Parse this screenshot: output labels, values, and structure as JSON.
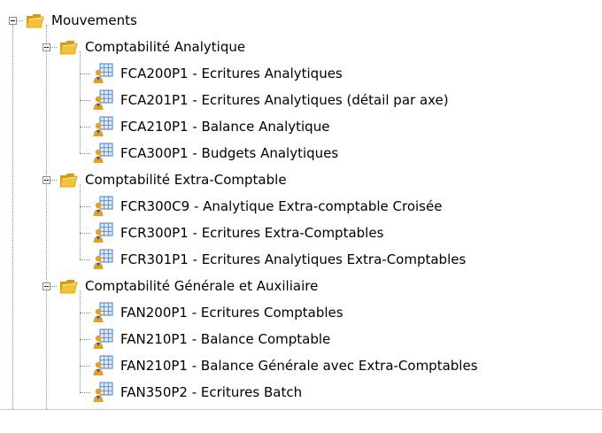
{
  "tree": {
    "root": {
      "label": "Mouvements",
      "icon": "folder-open-icon",
      "expanded": true
    },
    "groups": [
      {
        "label": "Comptabilité Analytique",
        "icon": "folder-open-icon",
        "expanded": true,
        "items": [
          {
            "label": "FCA200P1 - Ecritures Analytiques",
            "icon": "report-icon"
          },
          {
            "label": "FCA201P1 - Ecritures Analytiques (détail par axe)",
            "icon": "report-icon"
          },
          {
            "label": "FCA210P1 - Balance Analytique",
            "icon": "report-icon"
          },
          {
            "label": "FCA300P1 - Budgets Analytiques",
            "icon": "report-icon"
          }
        ]
      },
      {
        "label": "Comptabilité Extra-Comptable",
        "icon": "folder-open-icon",
        "expanded": true,
        "items": [
          {
            "label": "FCR300C9 - Analytique Extra-comptable Croisée",
            "icon": "report-icon"
          },
          {
            "label": "FCR300P1 - Ecritures Extra-Comptables",
            "icon": "report-icon"
          },
          {
            "label": "FCR301P1 - Ecritures Analytiques Extra-Comptables",
            "icon": "report-icon"
          }
        ]
      },
      {
        "label": "Comptabilité Générale et Auxiliaire",
        "icon": "folder-open-icon",
        "expanded": true,
        "items": [
          {
            "label": "FAN200P1 - Ecritures Comptables",
            "icon": "report-icon"
          },
          {
            "label": "FAN210P1 - Balance Comptable",
            "icon": "report-icon"
          },
          {
            "label": "FAN210P1 - Balance Générale avec Extra-Comptables",
            "icon": "report-icon"
          },
          {
            "label": "FAN350P2 - Ecritures Batch",
            "icon": "report-icon"
          }
        ]
      }
    ]
  },
  "colors": {
    "folder": "#f2c23c",
    "folder_dark": "#d89a10",
    "report_grid": "#4a7fc4",
    "report_figure": "#e8a020"
  }
}
